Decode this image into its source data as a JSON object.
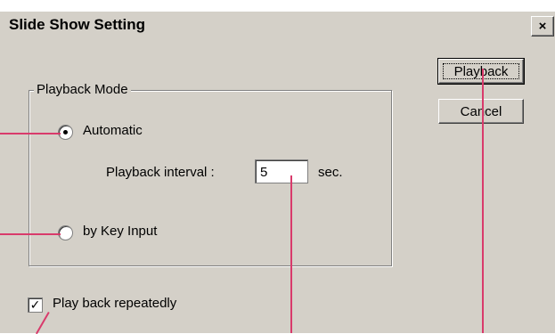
{
  "dialog": {
    "title": "Slide Show Setting",
    "close_glyph": "×"
  },
  "playback_mode": {
    "legend": "Playback Mode",
    "options": [
      {
        "label": "Automatic",
        "selected": true
      },
      {
        "label": "by Key Input",
        "selected": false
      }
    ],
    "interval_label": "Playback interval :",
    "interval_value": "5",
    "interval_unit": "sec."
  },
  "repeat": {
    "label": "Play back repeatedly",
    "checked": true,
    "check_glyph": "✓"
  },
  "buttons": {
    "playback": "Playback",
    "cancel": "Cancel"
  },
  "colors": {
    "callout": "#d93a6b",
    "dialog_bg": "#d4d0c8"
  }
}
